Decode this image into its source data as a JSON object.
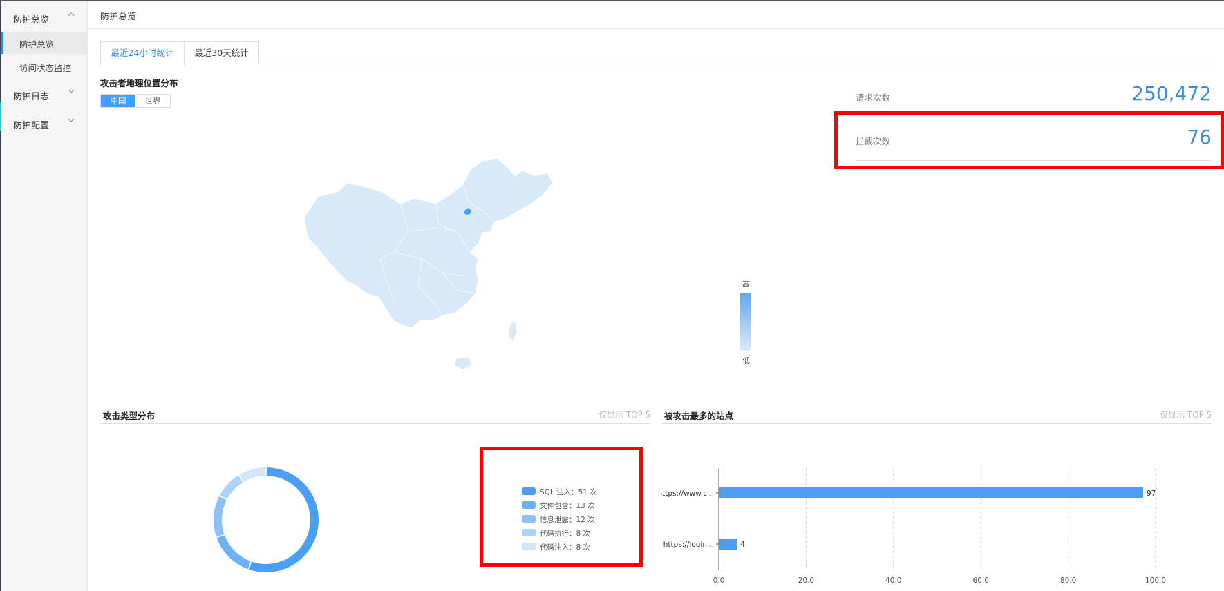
{
  "sidebar": {
    "groups": [
      {
        "label": "防护总览",
        "expanded": true,
        "items": [
          {
            "label": "防护总览",
            "active": true
          },
          {
            "label": "访问状态监控",
            "active": false
          }
        ]
      },
      {
        "label": "防护日志",
        "expanded": false
      },
      {
        "label": "防护配置",
        "expanded": false
      }
    ]
  },
  "header": {
    "breadcrumb": "防护总览"
  },
  "tabs": [
    {
      "label": "最近24小时统计",
      "active": true
    },
    {
      "label": "最近30天统计",
      "active": false
    }
  ],
  "geo": {
    "title": "攻击者地理位置分布",
    "toggle": [
      {
        "label": "中国",
        "active": true
      },
      {
        "label": "世界",
        "active": false
      }
    ],
    "visual_map": {
      "high": "高",
      "low": "低",
      "colors": [
        "#5aa7f5",
        "#dcebfb"
      ]
    },
    "map_base_color": "#d8e9fa",
    "map_hotspot_color": "#4a9df0"
  },
  "stats": {
    "requests": {
      "label": "请求次数",
      "value": "250,472"
    },
    "blocked": {
      "label": "拦截次数",
      "value": "76"
    }
  },
  "attack_types": {
    "title": "攻击类型分布",
    "note": "仅显示 TOP 5",
    "legend": [
      {
        "text": "SQL 注入：51 次",
        "color": "#4a9ff5"
      },
      {
        "text": "文件包含：13 次",
        "color": "#6cb0f6"
      },
      {
        "text": "信息泄露：12 次",
        "color": "#8cc0f7"
      },
      {
        "text": "代码执行：8 次",
        "color": "#add3f9"
      },
      {
        "text": "代码注入：8 次",
        "color": "#d2e6fb"
      }
    ]
  },
  "top_sites": {
    "title": "被攻击最多的站点",
    "note": "仅显示 TOP 5"
  },
  "chart_data": [
    {
      "type": "pie",
      "donut": true,
      "categories": [
        "SQL 注入",
        "文件包含",
        "信息泄露",
        "代码执行",
        "代码注入"
      ],
      "values": [
        51,
        13,
        12,
        8,
        8
      ],
      "colors": [
        "#4a9ff5",
        "#6cb0f6",
        "#8cc0f7",
        "#add3f9",
        "#d2e6fb"
      ]
    },
    {
      "type": "bar",
      "orientation": "horizontal",
      "categories": [
        "https://www.c...",
        "https://login..."
      ],
      "values": [
        97,
        4
      ],
      "xlim": [
        0,
        100
      ],
      "xticks": [
        "0.0",
        "20.0",
        "40.0",
        "60.0",
        "80.0",
        "100.0"
      ],
      "grid": true,
      "color": "#4a9ff5"
    }
  ]
}
